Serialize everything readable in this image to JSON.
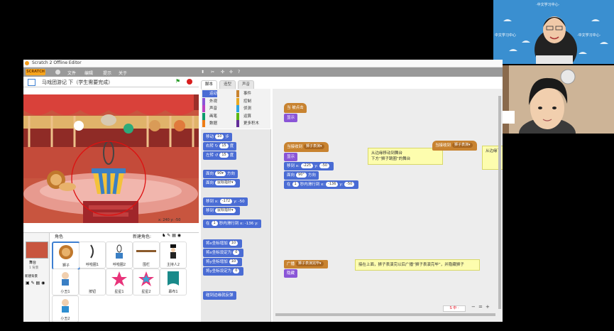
{
  "teacher_video": {
    "banner_lines": [
      "·中文学习中心·",
      "中文学习中心",
      "·中文学习中心·"
    ]
  },
  "window": {
    "title": "Scratch 2 Offline Editor"
  },
  "menu": {
    "logo": "SCRATCH",
    "file": "文件",
    "edit": "编辑",
    "hint": "提示",
    "about": "关于"
  },
  "stage": {
    "project_title": "马戏团游记 下（学生需要完成）",
    "coords": "x: 240  y: -50"
  },
  "sprites": {
    "header": "角色",
    "new_sprite": "新建角色:",
    "stage_label": "舞台",
    "stage_sub": "1 背景",
    "new_backdrop": "新建背景",
    "items": [
      {
        "label": "狮子"
      },
      {
        "label": "呼啦圈1"
      },
      {
        "label": "呼啦圈2"
      },
      {
        "label": "围栏"
      },
      {
        "label": "主持人2"
      },
      {
        "label": "小丑1"
      },
      {
        "label": "按钮"
      },
      {
        "label": "星星1"
      },
      {
        "label": "星星2"
      },
      {
        "label": "幕布1"
      },
      {
        "label": "小丑2"
      }
    ]
  },
  "tabs": {
    "scripts": "脚本",
    "costumes": "造型",
    "sounds": "声音"
  },
  "categories": [
    {
      "label": "运动",
      "color": "#4a6cd4"
    },
    {
      "label": "事件",
      "color": "#c88330"
    },
    {
      "label": "外观",
      "color": "#8a55d7"
    },
    {
      "label": "控制",
      "color": "#e6a823"
    },
    {
      "label": "声音",
      "color": "#bb42c3"
    },
    {
      "label": "侦测",
      "color": "#2ca5e2"
    },
    {
      "label": "画笔",
      "color": "#0e9a6c"
    },
    {
      "label": "运算",
      "color": "#5cb712"
    },
    {
      "label": "数据",
      "color": "#ee7d16"
    },
    {
      "label": "更多积木",
      "color": "#632d99"
    }
  ],
  "palette_blocks": [
    {
      "text": "移动",
      "val": "10",
      "suffix": "步"
    },
    {
      "text": "右转 ↻",
      "val": "15",
      "suffix": "度"
    },
    {
      "text": "左转 ↺",
      "val": "15",
      "suffix": "度"
    },
    {
      "text": "面向",
      "val": "90▾",
      "suffix": "方向"
    },
    {
      "text": "面向",
      "val": "鼠标指针▾",
      "suffix": ""
    },
    {
      "text": "移到 x:",
      "val": "-172",
      "suffix": "y: -50"
    },
    {
      "text": "移到",
      "val": "鼠标指针▾",
      "suffix": ""
    },
    {
      "text": "在",
      "val": "1",
      "suffix": "秒内滑行到 x: -136 y:"
    },
    {
      "text": "将x坐标增加",
      "val": "10",
      "suffix": ""
    },
    {
      "text": "将x坐标设定为",
      "val": "0",
      "suffix": ""
    },
    {
      "text": "将y坐标增加",
      "val": "10",
      "suffix": ""
    },
    {
      "text": "将y坐标设定为",
      "val": "0",
      "suffix": ""
    },
    {
      "text": "碰到边缘就反弹",
      "val": "",
      "suffix": ""
    }
  ],
  "script": {
    "hat1": "当 被点击",
    "hat1_sub": "显示",
    "hat2_prefix": "当接收到",
    "hat2_msg": "狮子表演▾",
    "show": "显示",
    "goto": "移到 x:",
    "goto_x": "-225",
    "goto_y": "-50",
    "face": "面向",
    "face_val": "90°",
    "face_suffix": "方向",
    "glide": "在",
    "glide_val": "1",
    "glide_text": "秒内滑行到 x:",
    "glide_x": "-136",
    "glide_y": "-50",
    "hat3_prefix": "当接收到",
    "hat3_msg": "狮子表演▾",
    "note1": "从边缘移动到舞台\n下方“狮子跳圈”的舞台",
    "note2": "从边缘下",
    "broadcast": "广播",
    "broadcast_msg": "狮子表演完毕▾",
    "hide": "隐藏",
    "note3": "接在上面，狮子表演完以后广播“狮子表演完毕”，并隐藏狮子"
  },
  "zoom": {
    "minus": "−",
    "equal": "=",
    "plus": "+"
  }
}
